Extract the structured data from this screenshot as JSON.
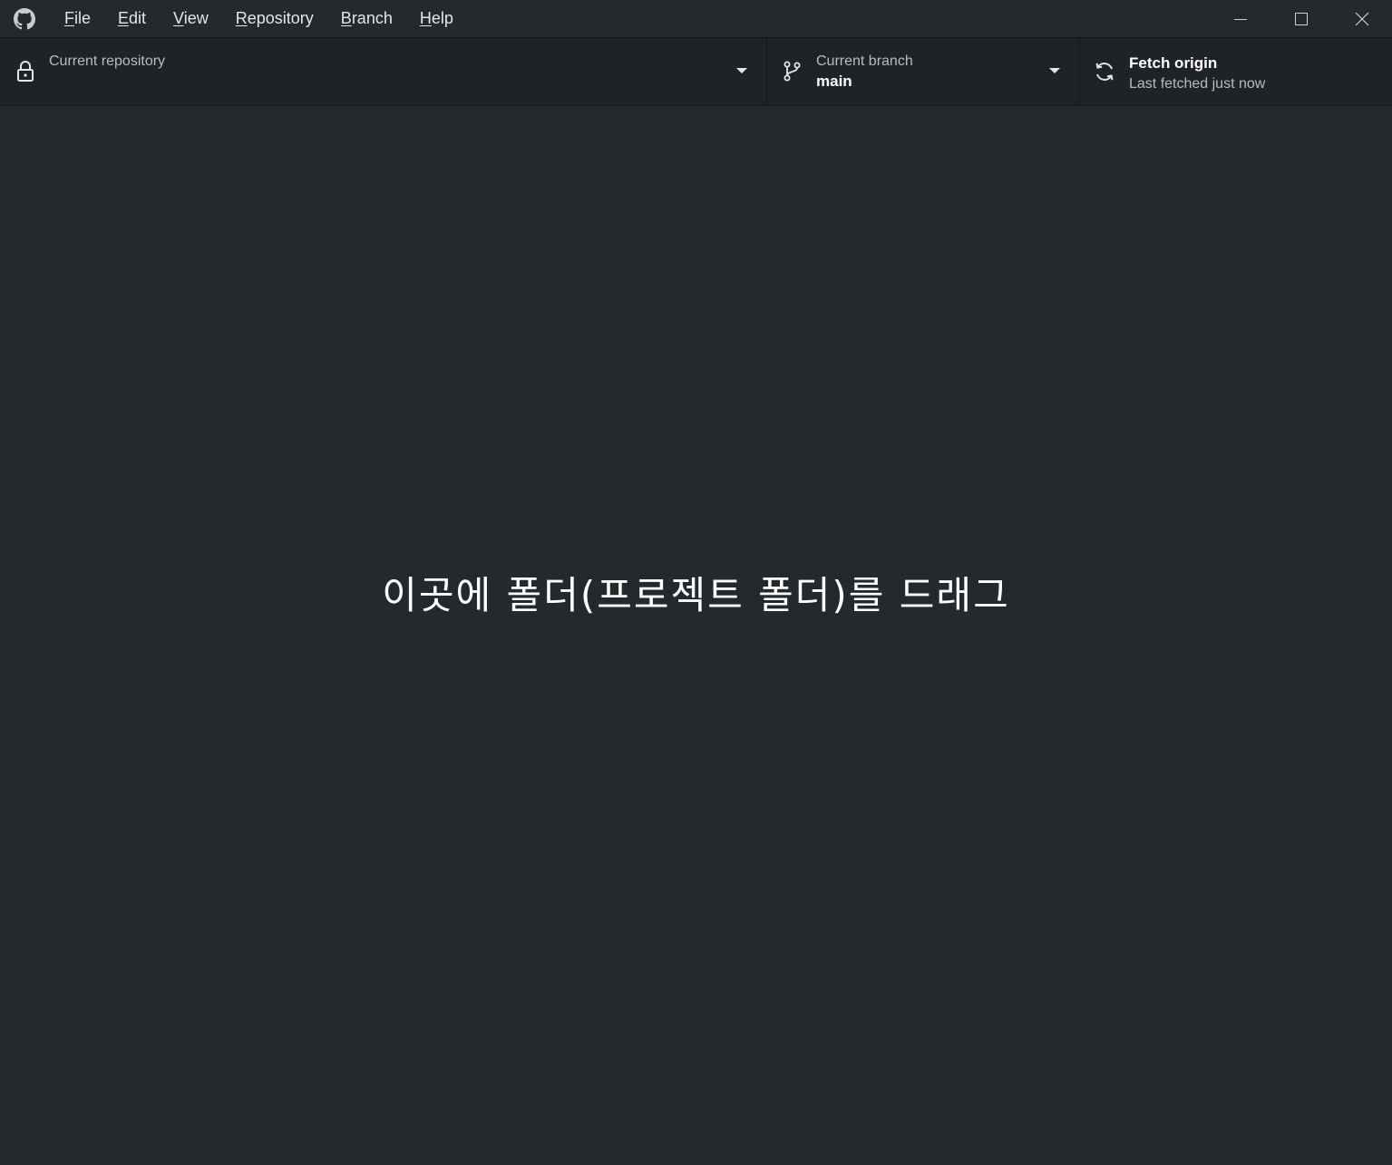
{
  "menu": {
    "items": [
      {
        "mnemonic": "F",
        "rest": "ile"
      },
      {
        "mnemonic": "E",
        "rest": "dit"
      },
      {
        "mnemonic": "V",
        "rest": "iew"
      },
      {
        "mnemonic": "R",
        "rest": "epository"
      },
      {
        "mnemonic": "B",
        "rest": "ranch"
      },
      {
        "mnemonic": "H",
        "rest": "elp"
      }
    ]
  },
  "toolbar": {
    "repository": {
      "label": "Current repository",
      "icon": "lock-icon"
    },
    "branch": {
      "label": "Current branch",
      "value": "main",
      "icon": "git-branch-icon"
    },
    "fetch": {
      "title": "Fetch origin",
      "subtitle": "Last fetched just now",
      "icon": "sync-icon"
    }
  },
  "main": {
    "drop_message": "이곳에 폴더(프로젝트 폴더)를 드래그"
  },
  "colors": {
    "background": "#24292e",
    "toolbar": "#1f2327",
    "text": "#ffffff",
    "muted_text": "#b7bcc1"
  }
}
